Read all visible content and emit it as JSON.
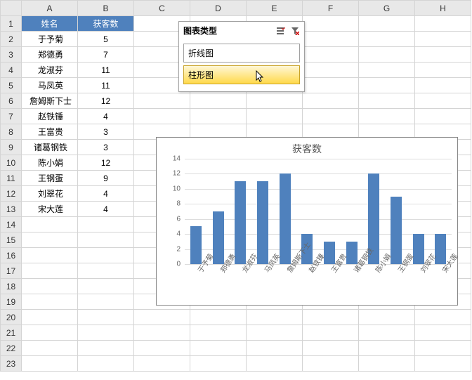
{
  "columns": [
    "A",
    "B",
    "C",
    "D",
    "E",
    "F",
    "G",
    "H"
  ],
  "row_count": 23,
  "table": {
    "headers": {
      "name": "姓名",
      "count": "获客数"
    },
    "rows": [
      {
        "name": "于予菊",
        "count": 5
      },
      {
        "name": "郑德勇",
        "count": 7
      },
      {
        "name": "龙淑芬",
        "count": 11
      },
      {
        "name": "马凤英",
        "count": 11
      },
      {
        "name": "詹姆斯下士",
        "count": 12
      },
      {
        "name": "赵铁锤",
        "count": 4
      },
      {
        "name": "王富贵",
        "count": 3
      },
      {
        "name": "诸葛钢铁",
        "count": 3
      },
      {
        "name": "陈小娟",
        "count": 12
      },
      {
        "name": "王钢蛋",
        "count": 9
      },
      {
        "name": "刘翠花",
        "count": 4
      },
      {
        "name": "宋大莲",
        "count": 4
      }
    ]
  },
  "slicer": {
    "title": "图表类型",
    "items": [
      {
        "label": "折线图",
        "hover": false
      },
      {
        "label": "柱形图",
        "hover": true
      }
    ]
  },
  "chart_data": {
    "type": "bar",
    "title": "获客数",
    "categories": [
      "于予菊",
      "郑德勇",
      "龙淑芬",
      "马凤英",
      "詹姆斯下士",
      "赵铁锤",
      "王富贵",
      "诸葛钢铁",
      "陈小娟",
      "王钢蛋",
      "刘翠花",
      "宋大莲"
    ],
    "values": [
      5,
      7,
      11,
      11,
      12,
      4,
      3,
      3,
      12,
      9,
      4,
      4
    ],
    "ylim": [
      0,
      14
    ],
    "yticks": [
      0,
      2,
      4,
      6,
      8,
      10,
      12,
      14
    ],
    "xlabel": "",
    "ylabel": ""
  },
  "colors": {
    "accent": "#4f81bd"
  }
}
